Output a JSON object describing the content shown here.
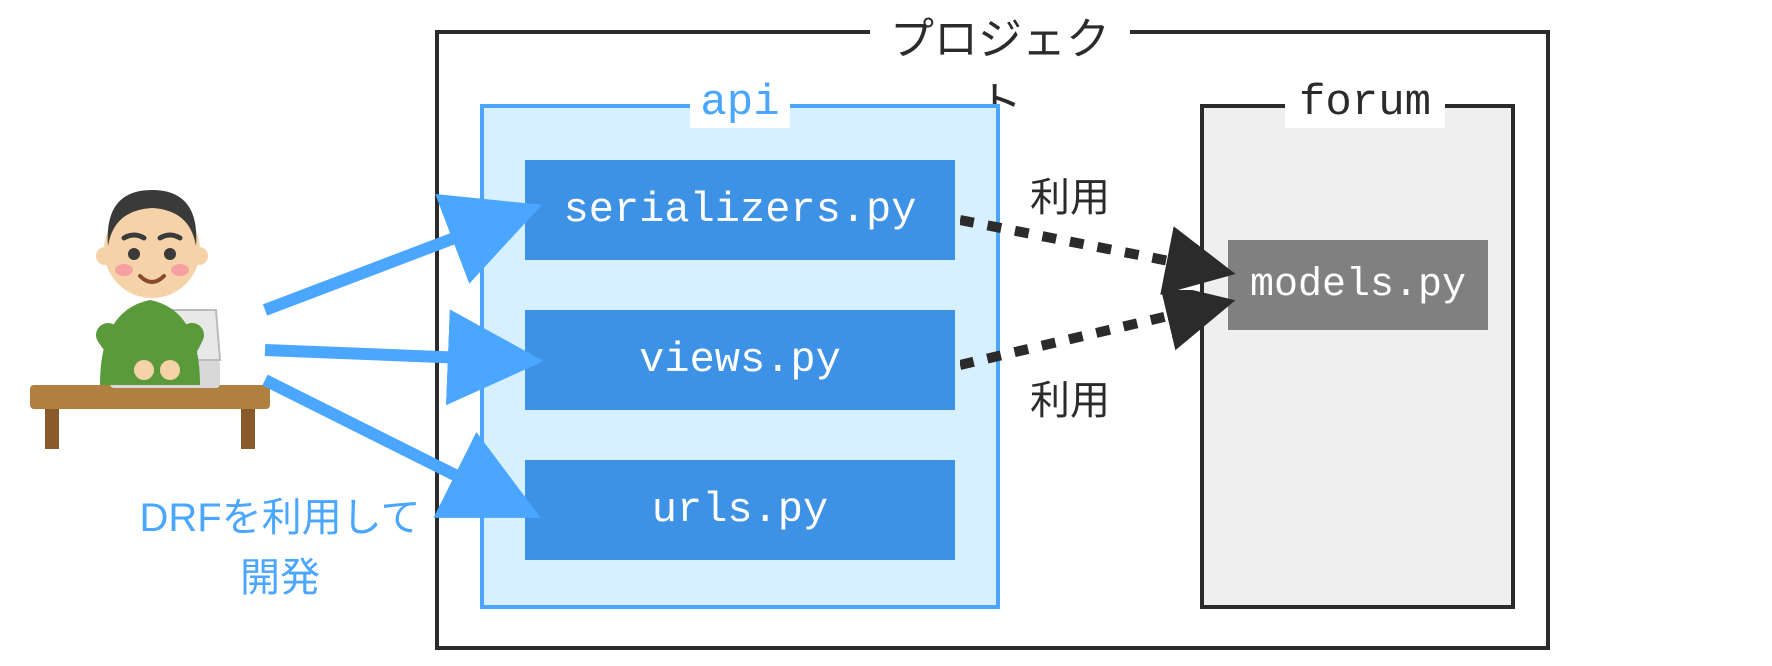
{
  "project": {
    "label": "プロジェクト"
  },
  "api": {
    "label": "api",
    "files": {
      "serializers": "serializers.py",
      "views": "views.py",
      "urls": "urls.py"
    }
  },
  "forum": {
    "label": "forum",
    "models": "models.py"
  },
  "developer": {
    "caption_line1": "DRFを利用して",
    "caption_line2": "開発"
  },
  "usage": {
    "label": "利用"
  },
  "colors": {
    "blue": "#4aa6ff",
    "file_blue": "#3e92e6",
    "api_bg": "#d6f0ff",
    "forum_bg": "#efefef",
    "gray_file": "#808080",
    "dark": "#2b2b2b"
  }
}
